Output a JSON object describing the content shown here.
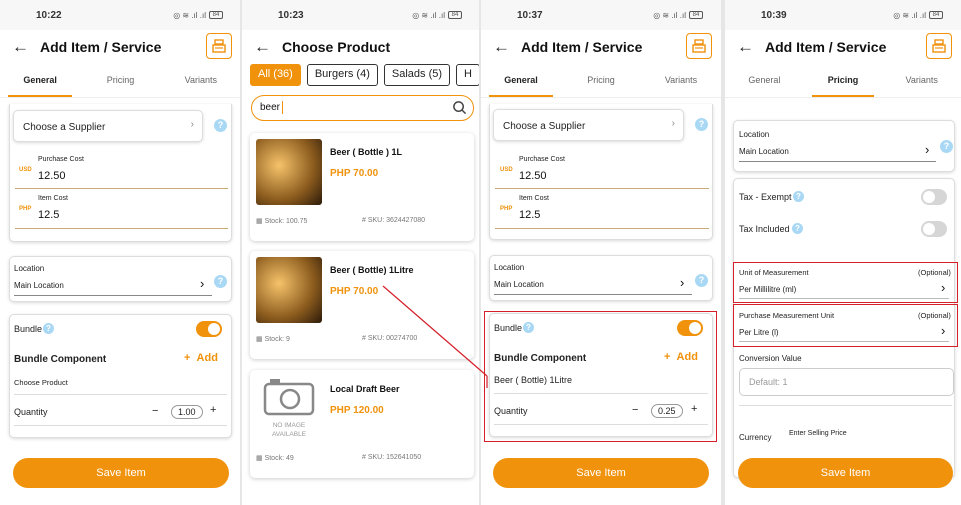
{
  "status": {
    "p1": "10:22",
    "p2": "10:23",
    "p3": "10:37",
    "p4": "10:39",
    "battery": "84"
  },
  "screen1": {
    "title": "Add Item / Service",
    "tabs": [
      "General",
      "Pricing",
      "Variants"
    ],
    "supplier": "Choose a Supplier",
    "purchase_cost_label": "Purchase Cost",
    "purchase_currency": "USD",
    "purchase_cost": "12.50",
    "item_cost_label": "Item Cost",
    "item_currency": "PHP",
    "item_cost": "12.5",
    "location_label": "Location",
    "location_value": "Main Location",
    "bundle_label": "Bundle",
    "bundle_component": "Bundle Component",
    "add": "Add",
    "choose_product": "Choose Product",
    "quantity_label": "Quantity",
    "quantity": "1.00",
    "save": "Save Item"
  },
  "screen2": {
    "title": "Choose Product",
    "chips": [
      "All (36)",
      "Burgers (4)",
      "Salads (5)",
      "H"
    ],
    "search_value": "beer",
    "products": [
      {
        "name": "Beer ( Bottle ) 1L",
        "price": "PHP 70.00",
        "stock": "Stock: 100.75",
        "sku": "SKU: 3624427080"
      },
      {
        "name": "Beer ( Bottle) 1Litre",
        "price": "PHP 70.00",
        "stock": "Stock: 9",
        "sku": "SKU: 00274700"
      },
      {
        "name": "Local Draft Beer",
        "price": "PHP 120.00",
        "stock": "Stock: 49",
        "sku": "SKU: 152641050",
        "no_image_1": "NO IMAGE",
        "no_image_2": "AVAILABLE"
      }
    ]
  },
  "screen3": {
    "title": "Add Item / Service",
    "tabs": [
      "General",
      "Pricing",
      "Variants"
    ],
    "supplier": "Choose a Supplier",
    "purchase_cost_label": "Purchase Cost",
    "purchase_currency": "USD",
    "purchase_cost": "12.50",
    "item_cost_label": "Item Cost",
    "item_currency": "PHP",
    "item_cost": "12.5",
    "location_label": "Location",
    "location_value": "Main Location",
    "bundle_label": "Bundle",
    "bundle_component": "Bundle Component",
    "add": "Add",
    "component_value": "Beer ( Bottle) 1Litre",
    "quantity_label": "Quantity",
    "quantity": "0.25",
    "save": "Save Item"
  },
  "screen4": {
    "title": "Add Item / Service",
    "tabs": [
      "General",
      "Pricing",
      "Variants"
    ],
    "location_label": "Location",
    "location_value": "Main Location",
    "tax_exempt": "Tax - Exempt",
    "tax_included": "Tax Included",
    "uom_label": "Unit of Measurement",
    "uom_optional": "(Optional)",
    "uom_value": "Per Millilitre (ml)",
    "pmu_label": "Purchase Measurement Unit",
    "pmu_optional": "(Optional)",
    "pmu_value": "Per Litre (l)",
    "conversion_label": "Conversion Value",
    "conversion_placeholder": "Default: 1",
    "currency_label": "Currency",
    "selling_price_label": "Enter Selling Price",
    "save": "Save Item"
  },
  "colors": {
    "accent": "#f0920c",
    "highlight": "#d5202a",
    "help": "#a9d8f5"
  },
  "icons": [
    "back-arrow-icon",
    "cash-register-icon",
    "search-icon",
    "help-icon",
    "chevron-right-icon",
    "camera-icon",
    "stock-icon",
    "sku-icon",
    "plus-icon",
    "minus-icon"
  ]
}
